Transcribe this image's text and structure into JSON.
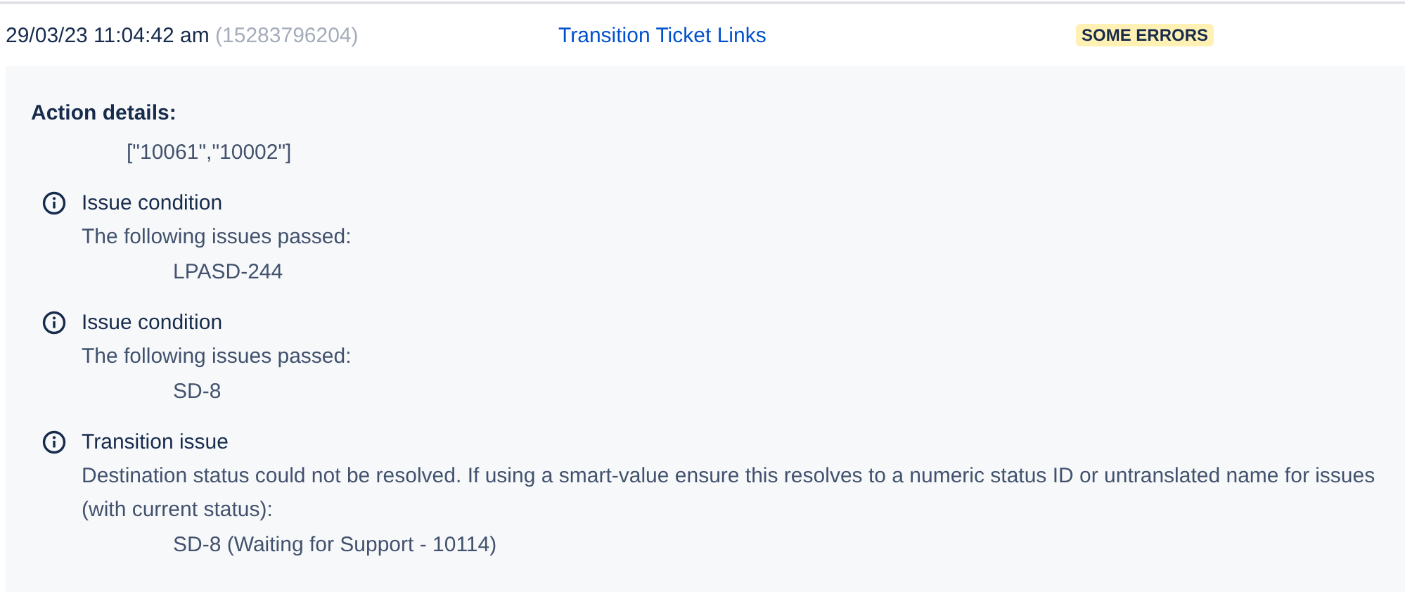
{
  "entry": {
    "timestamp": "29/03/23 11:04:42 am",
    "id": "(15283796204)",
    "rule_link": "Transition Ticket Links",
    "status": "SOME ERRORS"
  },
  "details": {
    "heading": "Action details:",
    "value": "[\"10061\",\"10002\"]",
    "items": [
      {
        "title": "Issue condition",
        "message": "The following issues passed:",
        "issue": "LPASD-244"
      },
      {
        "title": "Issue condition",
        "message": "The following issues passed:",
        "issue": "SD-8"
      },
      {
        "title": "Transition issue",
        "message": "Destination status could not be resolved. If using a smart-value ensure this resolves to a numeric status ID or untranslated name for issues (with current status):",
        "issue": "SD-8 (Waiting for Support - 10114)"
      }
    ]
  }
}
